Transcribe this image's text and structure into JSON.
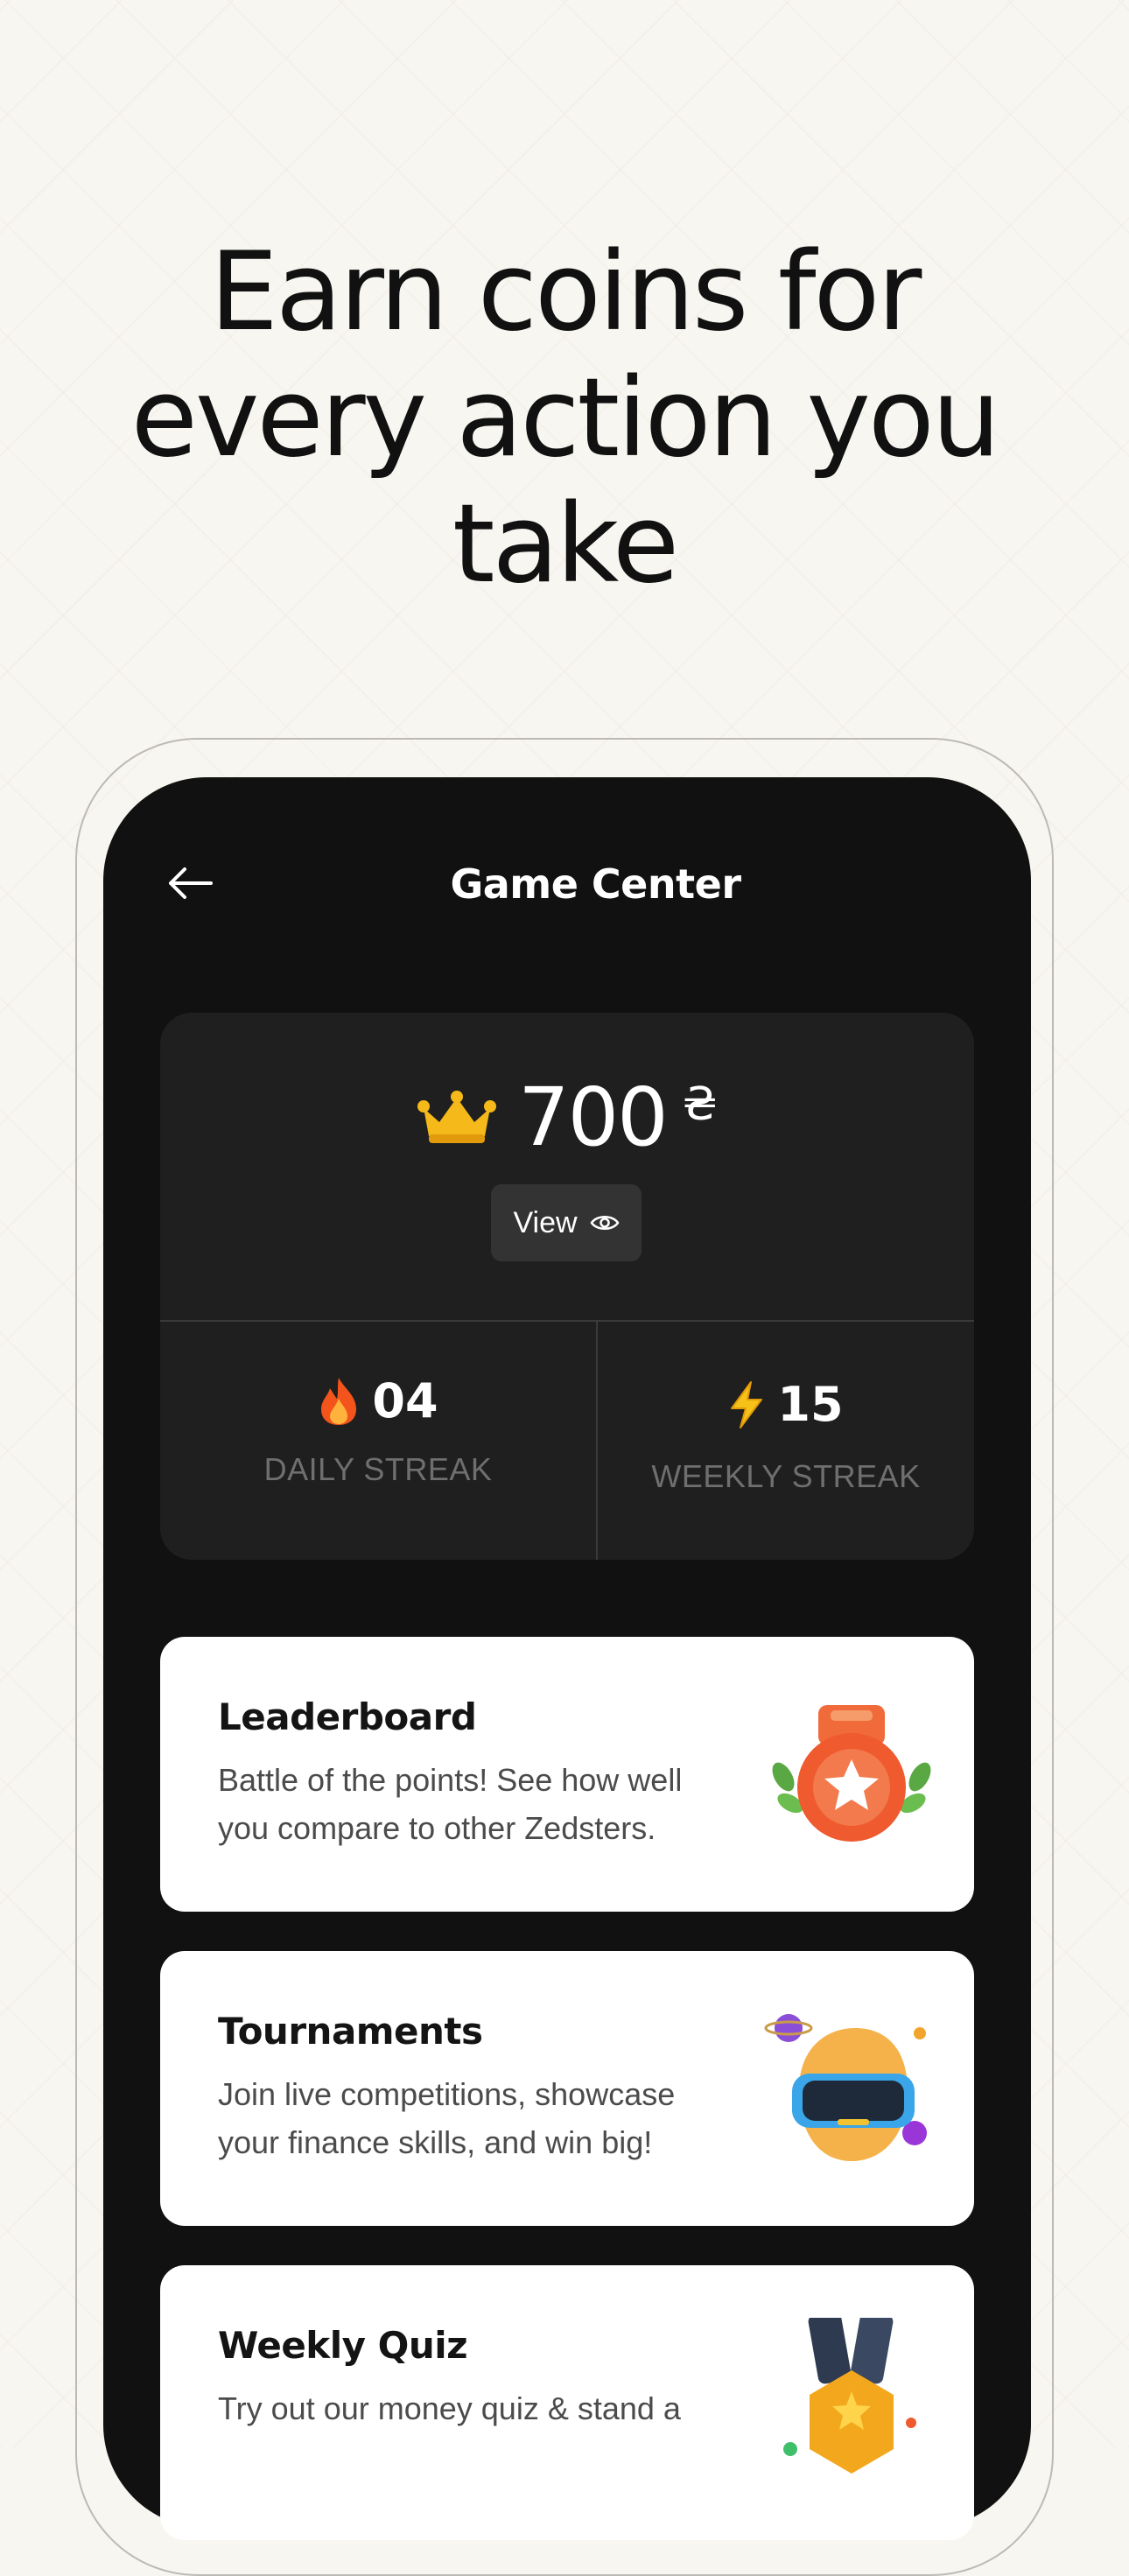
{
  "headline": {
    "line1": "Earn coins for",
    "line2": "every action you",
    "line3": "take"
  },
  "screen": {
    "title": "Game Center",
    "back_icon": "arrow-left-icon"
  },
  "coins": {
    "icon": "crown-icon",
    "value": "700",
    "currency_symbol": "₴",
    "view_label": "View",
    "view_icon": "eye-icon"
  },
  "streaks": {
    "daily": {
      "icon": "fire-icon",
      "value": "04",
      "label": "DAILY STREAK"
    },
    "weekly": {
      "icon": "lightning-icon",
      "value": "15",
      "label": "WEEKLY STREAK"
    }
  },
  "features": [
    {
      "title": "Leaderboard",
      "description": "Battle of the points! See how well you compare to other Zedsters.",
      "icon": "medal-icon"
    },
    {
      "title": "Tournaments",
      "description": "Join live competitions, showcase your finance skills, and win big!",
      "icon": "vr-avatar-icon"
    },
    {
      "title": "Weekly Quiz",
      "description": "Try out our money quiz & stand a",
      "icon": "quiz-badge-icon"
    }
  ],
  "colors": {
    "background": "#f8f6f1",
    "screen": "#111111",
    "card_dark": "#1f1f1f",
    "card_light": "#ffffff",
    "accent_gold": "#f6b91a",
    "accent_orange": "#ef5a2f"
  }
}
